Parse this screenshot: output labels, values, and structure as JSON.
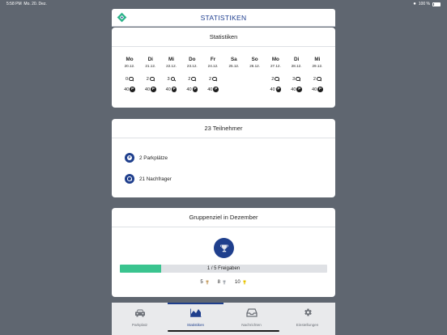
{
  "status_bar": {
    "time": "5:58 PM",
    "date": "Mo. 20. Dez.",
    "battery": "100 %"
  },
  "navbar": {
    "title": "STATISTIKEN",
    "logo_icon": "diamond-logo-icon"
  },
  "stats_card": {
    "title": "Statistiken",
    "days": [
      {
        "name": "Mo",
        "date": "20.12.",
        "seekers": "0",
        "spots": "40"
      },
      {
        "name": "Di",
        "date": "21.12.",
        "seekers": "2",
        "spots": "40"
      },
      {
        "name": "Mi",
        "date": "22.12.",
        "seekers": "3",
        "spots": "40"
      },
      {
        "name": "Do",
        "date": "23.12.",
        "seekers": "2",
        "spots": "40"
      },
      {
        "name": "Fr",
        "date": "24.12.",
        "seekers": "2",
        "spots": "40"
      },
      {
        "name": "Sa",
        "date": "25.12.",
        "seekers": null,
        "spots": null
      },
      {
        "name": "So",
        "date": "26.12.",
        "seekers": null,
        "spots": null
      },
      {
        "name": "Mo",
        "date": "27.12.",
        "seekers": "2",
        "spots": "40"
      },
      {
        "name": "Di",
        "date": "28.12.",
        "seekers": "3",
        "spots": "40"
      },
      {
        "name": "Mi",
        "date": "29.12.",
        "seekers": "2",
        "spots": "40"
      }
    ]
  },
  "participants_card": {
    "title": "23 Teilnehmer",
    "items": [
      {
        "label": "2 Parkplätze",
        "icon": "parking-icon"
      },
      {
        "label": "21 Nachfrager",
        "icon": "search-icon"
      }
    ]
  },
  "goal_card": {
    "title": "Gruppenziel in Dezember",
    "progress_text": "1 / 5 Freigaben",
    "progress_fraction": 0.2,
    "awards": [
      {
        "count": "5",
        "icon": "bronze-trophy-icon",
        "color": "#c9a36a"
      },
      {
        "count": "8",
        "icon": "silver-trophy-icon",
        "color": "#a7acb3"
      },
      {
        "count": "10",
        "icon": "gold-trophy-icon",
        "color": "#e8c400"
      }
    ]
  },
  "tabbar": {
    "tabs": [
      {
        "label": "Parkplatz",
        "icon": "car-icon"
      },
      {
        "label": "Statistiken",
        "icon": "chart-icon"
      },
      {
        "label": "Nachrichten",
        "icon": "inbox-icon"
      },
      {
        "label": "Einstellungen",
        "icon": "gear-icon"
      }
    ],
    "active_index": 1
  },
  "colors": {
    "accent": "#1f3f8d",
    "progress": "#3ac48f",
    "background": "#5f6670"
  }
}
